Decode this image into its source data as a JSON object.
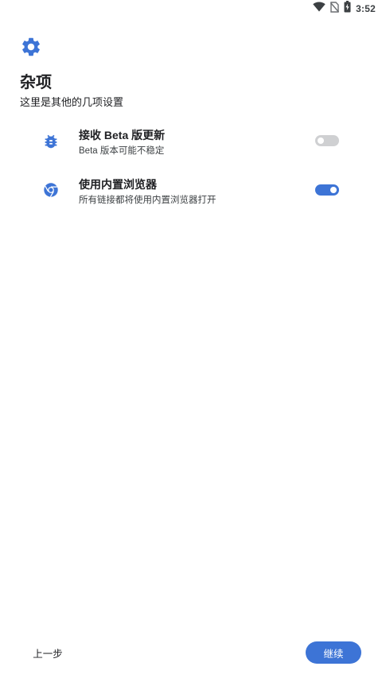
{
  "status_bar": {
    "time": "3:52",
    "icons": [
      "wifi-icon",
      "no-sim-icon",
      "battery-charging-icon"
    ]
  },
  "header": {
    "icon": "gear-icon",
    "accent_color": "#3d74d6",
    "title": "杂项",
    "subtitle": "这里是其他的几项设置"
  },
  "preferences": [
    {
      "icon": "bug-icon",
      "title": "接收 Beta 版更新",
      "summary": "Beta 版本可能不稳定",
      "enabled": false
    },
    {
      "icon": "chrome-browser-icon",
      "title": "使用内置浏览器",
      "summary": "所有链接都将使用内置浏览器打开",
      "enabled": true
    }
  ],
  "footer": {
    "back_label": "上一步",
    "next_label": "继续"
  }
}
